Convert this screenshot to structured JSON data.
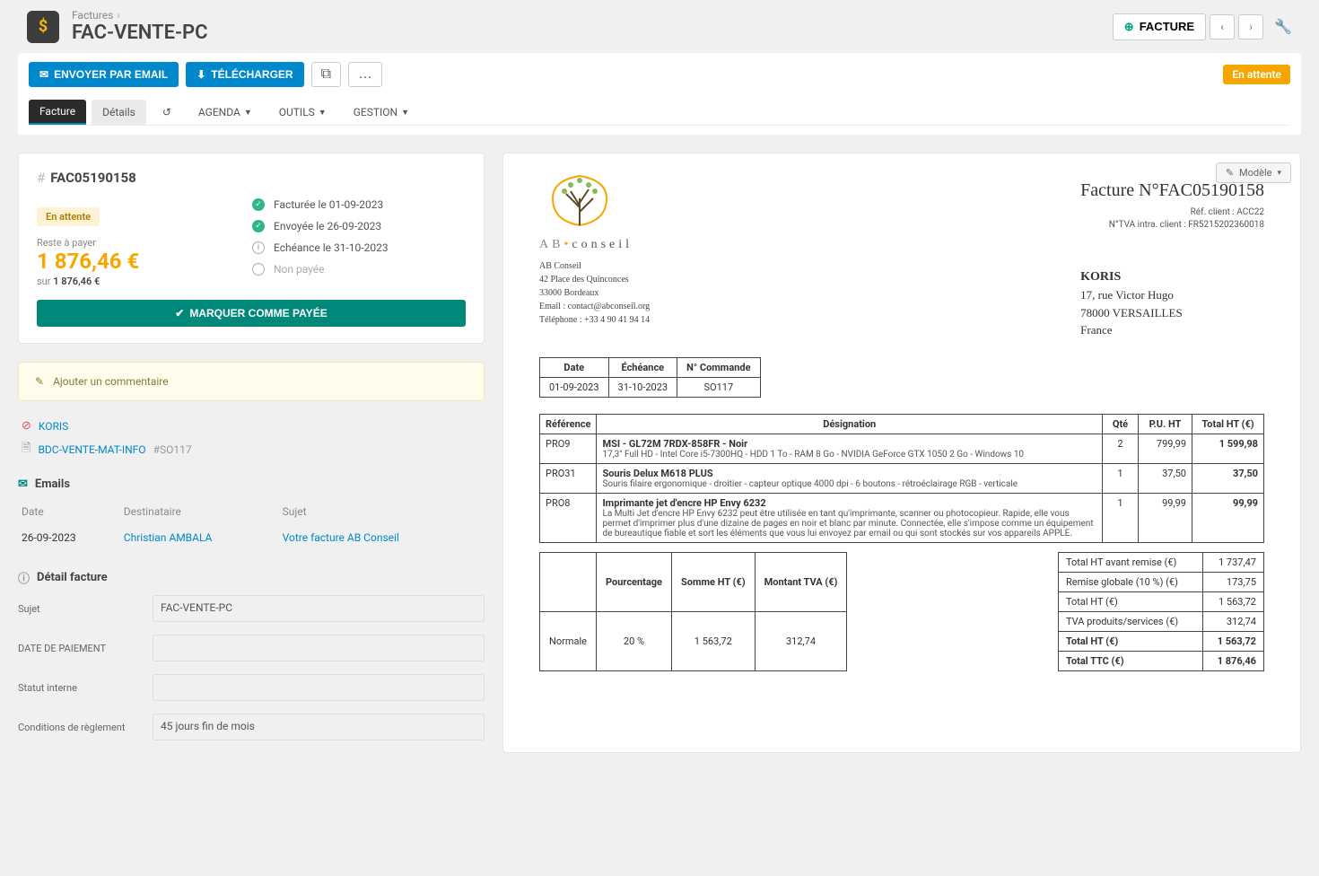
{
  "header": {
    "breadcrumb": "Factures",
    "title": "FAC-VENTE-PC",
    "btn_facture": "FACTURE"
  },
  "actions": {
    "email": "ENVOYER PAR EMAIL",
    "download": "TÉLÉCHARGER",
    "status": "En attente"
  },
  "tabs": {
    "facture": "Facture",
    "details": "Détails",
    "agenda": "AGENDA",
    "tools": "OUTILS",
    "gestion": "GESTION"
  },
  "summary": {
    "invoice_no": "FAC05190158",
    "status_pill": "En attente",
    "reste_label": "Reste à payer",
    "amount": "1 876,46 €",
    "sur": "sur",
    "sur_amount": "1 876,46 €",
    "timeline": [
      "Facturée le 01-09-2023",
      "Envoyée le 26-09-2023",
      "Echéance le 31-10-2023",
      "Non payée"
    ],
    "mark_paid": "MARQUER COMME PAYÉE"
  },
  "comment": {
    "add": "Ajouter un commentaire"
  },
  "links": {
    "koris": "KORIS",
    "bdc": "BDC-VENTE-MAT-INFO",
    "bdc_suffix": "#SO117"
  },
  "emails": {
    "title": "Emails",
    "th": [
      "Date",
      "Destinataire",
      "Sujet"
    ],
    "row": {
      "date": "26-09-2023",
      "dest": "Christian AMBALA",
      "subject": "Votre facture AB Conseil"
    }
  },
  "detail": {
    "title": "Détail facture",
    "subject_label": "Sujet",
    "subject_value": "FAC-VENTE-PC",
    "payment_date_label": "DATE DE PAIEMENT",
    "status_label": "Statut interne",
    "terms_label": "Conditions de règlement",
    "terms_value": "45 jours fin de mois"
  },
  "preview": {
    "model_btn": "Modèle",
    "title": "Facture N°FAC05190158",
    "ref_client": "Réf. client :  ACC22",
    "tva_client": "N°TVA intra. client :  FR5215202360018",
    "company": {
      "name": "AB Conseil",
      "addr1": "42 Place des Quinconces",
      "addr2": "33000 Bordeaux",
      "email": "Email : contact@abconseil.org",
      "phone": "Téléphone : +33 4 90 41 94 14",
      "brand_a": "AB",
      "brand_b": "conseil"
    },
    "client": {
      "name": "KORIS",
      "addr": "17, rue Victor Hugo",
      "city": "78000 VERSAILLES",
      "country": "France"
    },
    "meta_th": [
      "Date",
      "Échéance",
      "N° Commande"
    ],
    "meta_td": [
      "01-09-2023",
      "31-10-2023",
      "SO117"
    ],
    "lines_th": [
      "Référence",
      "Désignation",
      "Qté",
      "P.U. HT",
      "Total HT (€)"
    ],
    "lines": [
      {
        "ref": "PRO9",
        "name": "MSI - GL72M 7RDX-858FR - Noir",
        "desc": "17,3\" Full HD - Intel Core i5-7300HQ - HDD 1 To - RAM 8 Go - NVIDIA GeForce GTX 1050 2 Go - Windows 10",
        "qty": "2",
        "pu": "799,99",
        "tot": "1 599,98"
      },
      {
        "ref": "PRO31",
        "name": "Souris Delux M618 PLUS",
        "desc": "Souris filaire ergonomique - droitier - capteur optique 4000 dpi - 6 boutons - rétroéclairage RGB - verticale",
        "qty": "1",
        "pu": "37,50",
        "tot": "37,50"
      },
      {
        "ref": "PRO8",
        "name": "Imprimante jet d'encre HP Envy 6232",
        "desc": "La Multi Jet d'encre HP Envy 6232 peut être utilisée en tant qu'imprimante, scanner ou photocopieur. Rapide, elle vous permet d'imprimer plus d'une dizaine de pages en noir et blanc par minute. Connectée, elle s'impose comme un équipement de bureautique fiable et sort les éléments que vous lui envoyez par email ou qui sont stockés sur vos appareils APPLE.",
        "qty": "1",
        "pu": "99,99",
        "tot": "99,99"
      }
    ],
    "tax_th": [
      "",
      "Pourcentage",
      "Somme HT (€)",
      "Montant TVA (€)"
    ],
    "tax_row": [
      "Normale",
      "20 %",
      "1 563,72",
      "312,74"
    ],
    "totals": [
      {
        "l": "Total HT avant remise (€)",
        "v": "1 737,47"
      },
      {
        "l": "Remise globale (10 %) (€)",
        "v": "173,75"
      },
      {
        "l": "Total HT (€)",
        "v": "1 563,72"
      },
      {
        "l": "TVA produits/services (€)",
        "v": "312,74"
      },
      {
        "l": "Total HT (€)",
        "v": "1 563,72",
        "b": true
      },
      {
        "l": "Total TTC (€)",
        "v": "1 876,46",
        "b": true
      }
    ]
  }
}
